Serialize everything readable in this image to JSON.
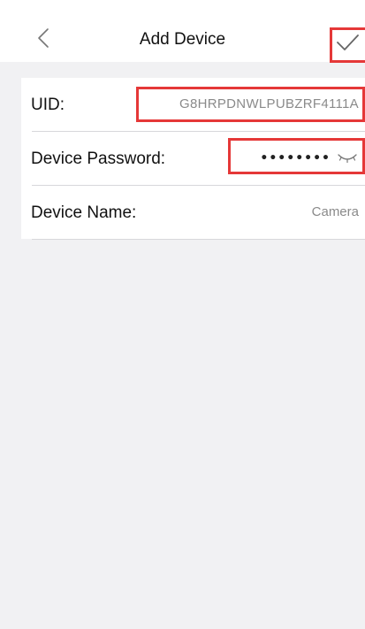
{
  "navbar": {
    "title": "Add Device"
  },
  "form": {
    "uid": {
      "label": "UID:",
      "value": "G8HRPDNWLPUBZRF4111A"
    },
    "password": {
      "label": "Device Password:",
      "value": "••••••••"
    },
    "name": {
      "label": "Device Name:",
      "value": "Camera"
    }
  },
  "icons": {
    "back": "chevron-left-icon",
    "confirm": "checkmark-icon",
    "password_toggle": "eye-closed-icon"
  },
  "colors": {
    "highlight": "#e53838",
    "background": "#f1f1f3",
    "surface": "#ffffff"
  }
}
